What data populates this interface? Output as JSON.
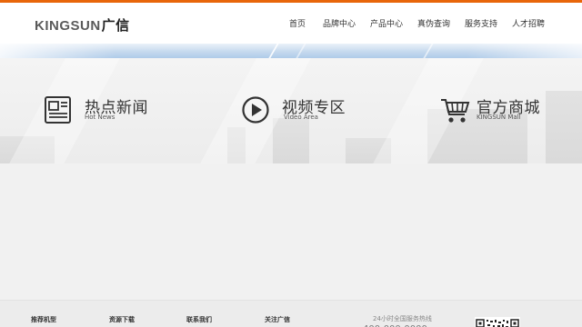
{
  "brand": {
    "logo_latin": "KINGSUN",
    "logo_cn": "广信",
    "accent_color": "#e8660a"
  },
  "nav": {
    "items": [
      {
        "label": "首页"
      },
      {
        "label": "品牌中心"
      },
      {
        "label": "产品中心"
      },
      {
        "label": "真伪查询"
      },
      {
        "label": "服务支持"
      },
      {
        "label": "人才招聘"
      }
    ]
  },
  "features": [
    {
      "title": "热点新闻",
      "subtitle": "Hot News",
      "icon": "newspaper-icon"
    },
    {
      "title": "视频专区",
      "subtitle": "Video Area",
      "icon": "play-circle-icon"
    },
    {
      "title": "官方商城",
      "subtitle": "KINGSUN Mall",
      "icon": "shopping-cart-icon"
    }
  ],
  "footer": {
    "columns": [
      {
        "label": "推荐机型"
      },
      {
        "label": "资源下载"
      },
      {
        "label": "联系我们"
      },
      {
        "label": "关注广信"
      }
    ],
    "hotline_label": "24小时全国服务热线",
    "hotline_number": "400-000-0000",
    "qr_icon": "qr-code-icon"
  }
}
